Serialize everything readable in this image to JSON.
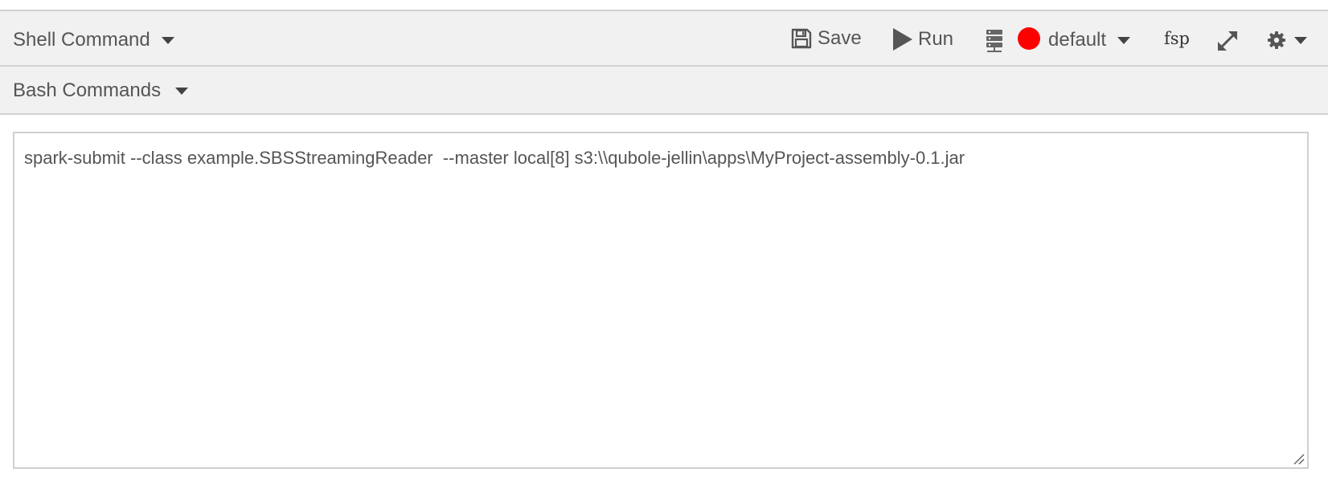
{
  "toolbar": {
    "command_type_label": "Shell Command",
    "save_label": "Save",
    "run_label": "Run",
    "cluster_label": "default",
    "cluster_status_color": "#ff0000",
    "fsp_label": "fsp"
  },
  "subbar": {
    "subtype_label": "Bash Commands"
  },
  "editor": {
    "content": "spark-submit --class example.SBSStreamingReader  --master local[8] s3:\\\\qubole-jellin\\apps\\MyProject-assembly-0.1.jar"
  },
  "icons": {
    "save": "floppy-disk-icon",
    "run": "play-icon",
    "cluster": "server-icon",
    "expand": "expand-arrows-icon",
    "settings": "gear-icon"
  }
}
